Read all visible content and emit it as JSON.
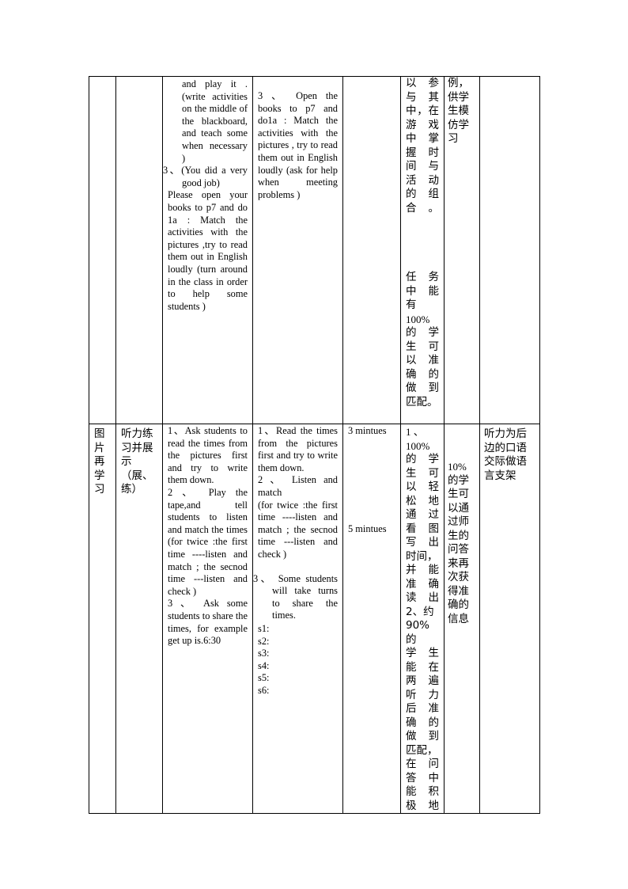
{
  "rows": [
    {
      "col1": [],
      "col2": [],
      "col3": {
        "cont": "and play it .(write activities on the middle of the blackboard, and teach some when necessary )",
        "item3": "3、(You did a very good job)",
        "rest": "Please open your books to p7 and do 1a : Match the activities with the pictures ,try to read them out in English loudly (turn around in the class in order to help some students )"
      },
      "col4": {
        "text": "3 、 Open the books to p7 and do1a : Match the activities with the pictures , try to read them out in English loudly (ask for help when meeting problems )"
      },
      "col5": [],
      "col6a": [
        "以参",
        "与其",
        "中，在",
        "游戏",
        "中掌",
        "握时",
        "间与",
        "活动",
        "的组",
        "合。"
      ],
      "col6b": [
        "任务",
        "中能",
        "有",
        "100%",
        "的学",
        "生可",
        "以准",
        "确的",
        "做到",
        "匹配。"
      ],
      "col7": [
        "例，",
        "供学",
        "生模",
        "仿学",
        "习"
      ],
      "col8": []
    },
    {
      "col1": [
        "图",
        "片",
        "再",
        "学",
        "习"
      ],
      "col2": [
        "听力练",
        "习并展",
        "示",
        "（展、",
        "练）"
      ],
      "col3": {
        "items": [
          "1、Ask students to read the times from the pictures first and try to write them down.",
          "2 、 Play the tape,and tell students to listen and match the times (for twice :the first time ----listen and match ; the secnod time ---listen and check )",
          "3 、 Ask some students to share the times, for example get up is.6:30"
        ]
      },
      "col4": {
        "items": [
          "1、Read the times from the pictures first and try to write them down.",
          "2 、 Listen and match",
          "(for twice :the first time ----listen and match ; the secnod time ---listen and check )"
        ],
        "item3": "3、 Some students will take turns to share the times.",
        "slots": [
          "s1:",
          "s2:",
          "s3:",
          "s4:",
          "s5:",
          "s6:"
        ]
      },
      "col5": [
        "3 mintues",
        "5 mintues"
      ],
      "col6": [
        "1 、",
        "100%",
        "的学",
        "生可",
        "以轻",
        "松地",
        "通过",
        "看图",
        "写出",
        "时间，",
        "并能",
        "准确",
        "读出",
        "2、约",
        "90%的",
        "学生",
        "能在",
        "两遍",
        "听力",
        "后准",
        "确的",
        "做到",
        "匹配，",
        "在问",
        "答中",
        "能积",
        "极地"
      ],
      "col7": [
        "10%",
        "的学",
        "生可",
        "以通",
        "过师",
        "生的",
        "问答",
        "来再",
        "次获",
        "得准",
        "确的",
        "信息"
      ],
      "col8": [
        "听力为后",
        "边的口语",
        "交际做语",
        "言支架"
      ]
    }
  ]
}
